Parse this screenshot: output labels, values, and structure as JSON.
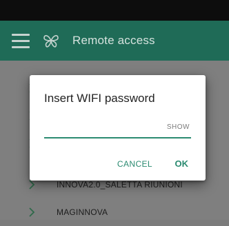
{
  "app_bar": {
    "title": "Remote access",
    "menu_icon": "hamburger-menu-icon",
    "logo_icon": "butterfly-logo-icon"
  },
  "networks": [
    {
      "name": ""
    },
    {
      "name": ""
    },
    {
      "name": ""
    },
    {
      "name": "INNOVA2.0_SALETTA RIUNIONI"
    },
    {
      "name": "MAGINNOVA"
    }
  ],
  "dialog": {
    "title": "Insert WIFI password",
    "password_value": "",
    "show_label": "SHOW",
    "cancel_label": "CANCEL",
    "ok_label": "OK"
  },
  "colors": {
    "app_bar": "#1f6b57",
    "accent": "#2a8a70",
    "status_bar": "#0d0d0d"
  }
}
